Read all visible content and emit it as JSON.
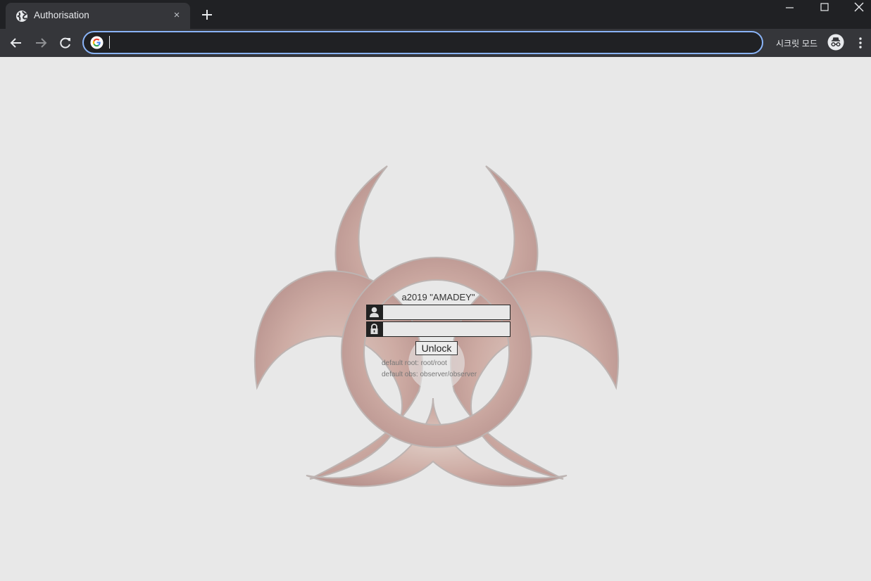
{
  "browser": {
    "tab": {
      "title": "Authorisation",
      "close": "×"
    },
    "omnibox": {
      "value": "",
      "placeholder": ""
    },
    "incognito_label": "시크릿 모드"
  },
  "login": {
    "title": "a2019 \"AMADEY\"",
    "username": {
      "value": "",
      "icon": "user-icon"
    },
    "password": {
      "value": "",
      "icon": "lock-icon"
    },
    "unlock_label": "Unlock",
    "hint_root": "default root: root/root",
    "hint_obs": "default obs: observer/observer"
  },
  "colors": {
    "chrome_dark": "#202124",
    "chrome_toolbar": "#35363a",
    "omnibox_focus": "#8ab4f8",
    "page_bg": "#e8e8e8",
    "emblem_rust": "#a0524a"
  }
}
